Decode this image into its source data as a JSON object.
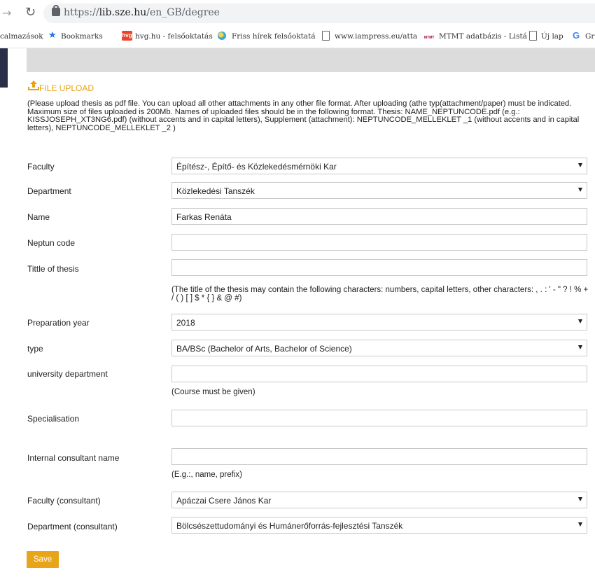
{
  "browser": {
    "url_scheme": "https://",
    "url_host": "lib.sze.hu",
    "url_path": "/en_GB/degree",
    "bookmarks": [
      {
        "label": "calmazások",
        "icon": "apps"
      },
      {
        "label": "Bookmarks",
        "icon": "star-icon"
      },
      {
        "label": "hvg.hu - felsőoktatás",
        "icon": "hvg-icon",
        "icon_text": "hvg"
      },
      {
        "label": "Friss hírek felsőoktatá",
        "icon": "friss-icon"
      },
      {
        "label": "www.iampress.eu/atta",
        "icon": "page-icon"
      },
      {
        "label": "MTMT adatbázis - Listá",
        "icon": "mtmt-icon",
        "icon_text": "MTMT"
      },
      {
        "label": "Új lap",
        "icon": "page-icon"
      },
      {
        "label": "Gr",
        "icon": "google-icon",
        "icon_text": "G"
      }
    ]
  },
  "section": {
    "title": "FILE UPLOAD",
    "intro": "(Please upload thesis as pdf file. You can upload all other attachments in any other file format. After uploading (athe typ(attachment/paper) must be indicated. Maximum size of files uploaded is 200Mb. Names of uploaded files should be in the following format. Thesis: NAME_NEPTUNCODE.pdf (e.g.: KISSJOSEPH_XT3NG6.pdf) (without accents and in capital letters), Supplement (attachment): NEPTUNCODE_MELLEKLET _1 (without accents and in capital letters), NEPTUNCODE_MELLEKLET _2 )"
  },
  "form": {
    "faculty": {
      "label": "Faculty",
      "value": "Építész-, Építő- és Közlekedésmérnöki Kar"
    },
    "department": {
      "label": "Department",
      "value": "Közlekedési Tanszék"
    },
    "name": {
      "label": "Name",
      "value": "Farkas Renáta"
    },
    "neptun": {
      "label": "Neptun code",
      "value": ""
    },
    "title": {
      "label": "Tittle of thesis",
      "value": "",
      "hint": "(The title of the thesis may contain the following characters: numbers, capital letters, other characters: , . : ' - \" ? ! % + / ( ) [ ] $ * { } & @ #)"
    },
    "year": {
      "label": "Preparation year",
      "value": "2018"
    },
    "type": {
      "label": "type",
      "value": "BA/BSc (Bachelor of Arts, Bachelor of Science)"
    },
    "univ_dept": {
      "label": "university department",
      "value": "",
      "hint": "(Course must be given)"
    },
    "specialisation": {
      "label": "Specialisation",
      "value": ""
    },
    "consultant": {
      "label": "Internal consultant name",
      "value": "",
      "hint": "(E.g.:, name, prefix)"
    },
    "faculty_consultant": {
      "label": "Faculty (consultant)",
      "value": "Apáczai Csere János Kar"
    },
    "department_consultant": {
      "label": "Department (consultant)",
      "value": "Bölcsészettudományi és Humánerőforrás-fejlesztési Tanszék"
    },
    "save_label": "Save"
  },
  "colors": {
    "accent": "#e9a51a",
    "banner": "#dcdcdc"
  }
}
